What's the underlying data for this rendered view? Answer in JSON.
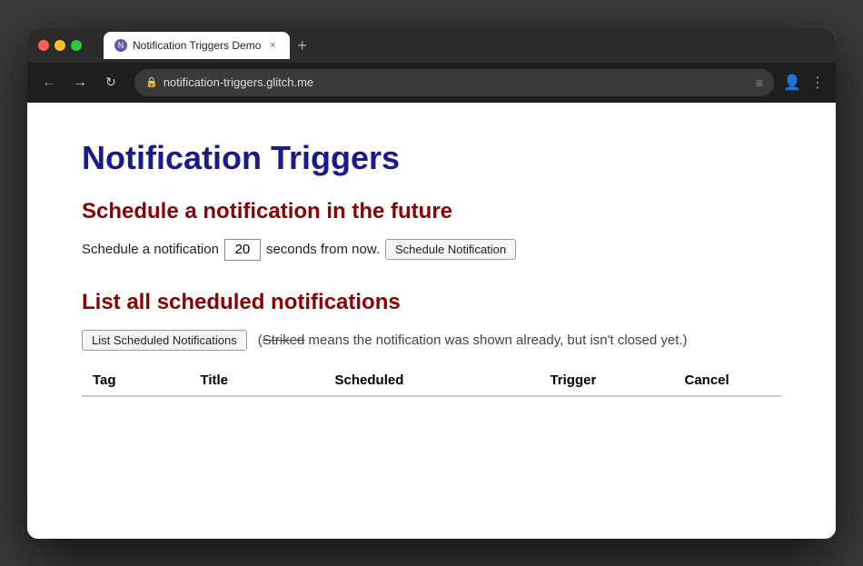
{
  "window": {
    "traffic_lights": {
      "close": "close",
      "minimize": "minimize",
      "maximize": "maximize"
    },
    "tab": {
      "favicon_label": "N",
      "title": "Notification Triggers Demo",
      "close_symbol": "×"
    },
    "new_tab_symbol": "+",
    "addressbar": {
      "back_arrow": "←",
      "forward_arrow": "→",
      "reload": "↻",
      "lock_icon": "🔒",
      "url": "notification-triggers.glitch.me",
      "menu_icon": "≡",
      "profile_icon": "👤",
      "more_icon": "⋮"
    }
  },
  "page": {
    "title": "Notification Triggers",
    "sections": [
      {
        "id": "schedule-section",
        "heading": "Schedule a notification in the future",
        "text_before": "Schedule a notification",
        "input_value": "20",
        "text_after": "seconds from now.",
        "button_label": "Schedule Notification"
      },
      {
        "id": "list-section",
        "heading": "List all scheduled notifications",
        "button_label": "List Scheduled Notifications",
        "note_prefix": "(",
        "note_striked": "Striked",
        "note_suffix": " means the notification was shown already, but isn't closed yet.)",
        "table": {
          "headers": [
            "Tag",
            "Title",
            "Scheduled",
            "Trigger",
            "Cancel"
          ],
          "rows": []
        }
      }
    ]
  }
}
